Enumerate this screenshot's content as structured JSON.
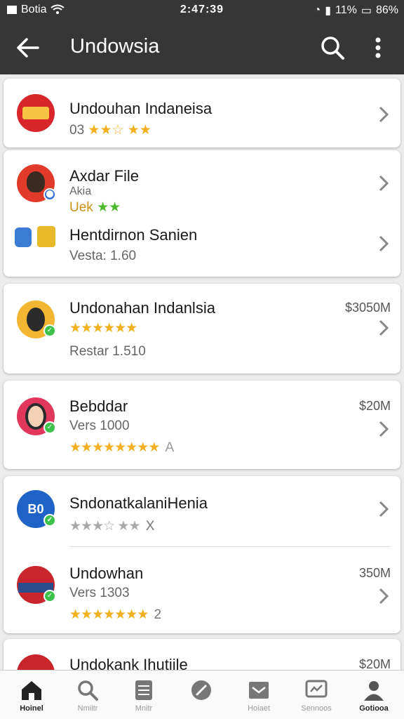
{
  "status_bar": {
    "carrier": "Botia",
    "time": "2:47:39",
    "signal_text": "11%",
    "battery": "86%"
  },
  "app_bar": {
    "title": "Undowsia"
  },
  "list": {
    "items": [
      {
        "title": "Undouhan Indaneisa",
        "sub": "03",
        "stars": "★★☆ ★★"
      },
      {
        "title": "Axdar File",
        "sub": "Akia",
        "sub2": "Uek",
        "stars": "★★"
      },
      {
        "title": "Hentdirnon Sanien",
        "sub": "Vesta: 1.60"
      },
      {
        "title": "Undonahan Indanlsia",
        "size": "$3050M",
        "stars": "★★★★★★",
        "sub": "Restar 1.510"
      },
      {
        "title": "Bebddar",
        "size": "$20M",
        "sub": "Vers 1000",
        "stars": "★★★★★★★★",
        "trailer": "A"
      },
      {
        "title": "SndonatkalaniHenia",
        "avatar_text": "B0",
        "stars": "★★★☆ ★★",
        "trailer": "X"
      },
      {
        "title": "Undowhan",
        "size": "350M",
        "sub": "Vers 1303",
        "stars": "★★★★★★★",
        "trailer": "2"
      },
      {
        "title": "Undokank Ihutiile",
        "size": "$20M"
      }
    ]
  },
  "bottom_nav": [
    {
      "label": "Hoinel"
    },
    {
      "label": "Nmiitr"
    },
    {
      "label": "Mnitr"
    },
    {
      "label": ""
    },
    {
      "label": "Hoiaet"
    },
    {
      "label": "Sennoos"
    },
    {
      "label": "Gotiooa"
    }
  ],
  "colors": {
    "bar": "#363636",
    "star_gold": "#f2b01e",
    "star_green": "#4cbb2b",
    "badge": "#3cc24a"
  }
}
